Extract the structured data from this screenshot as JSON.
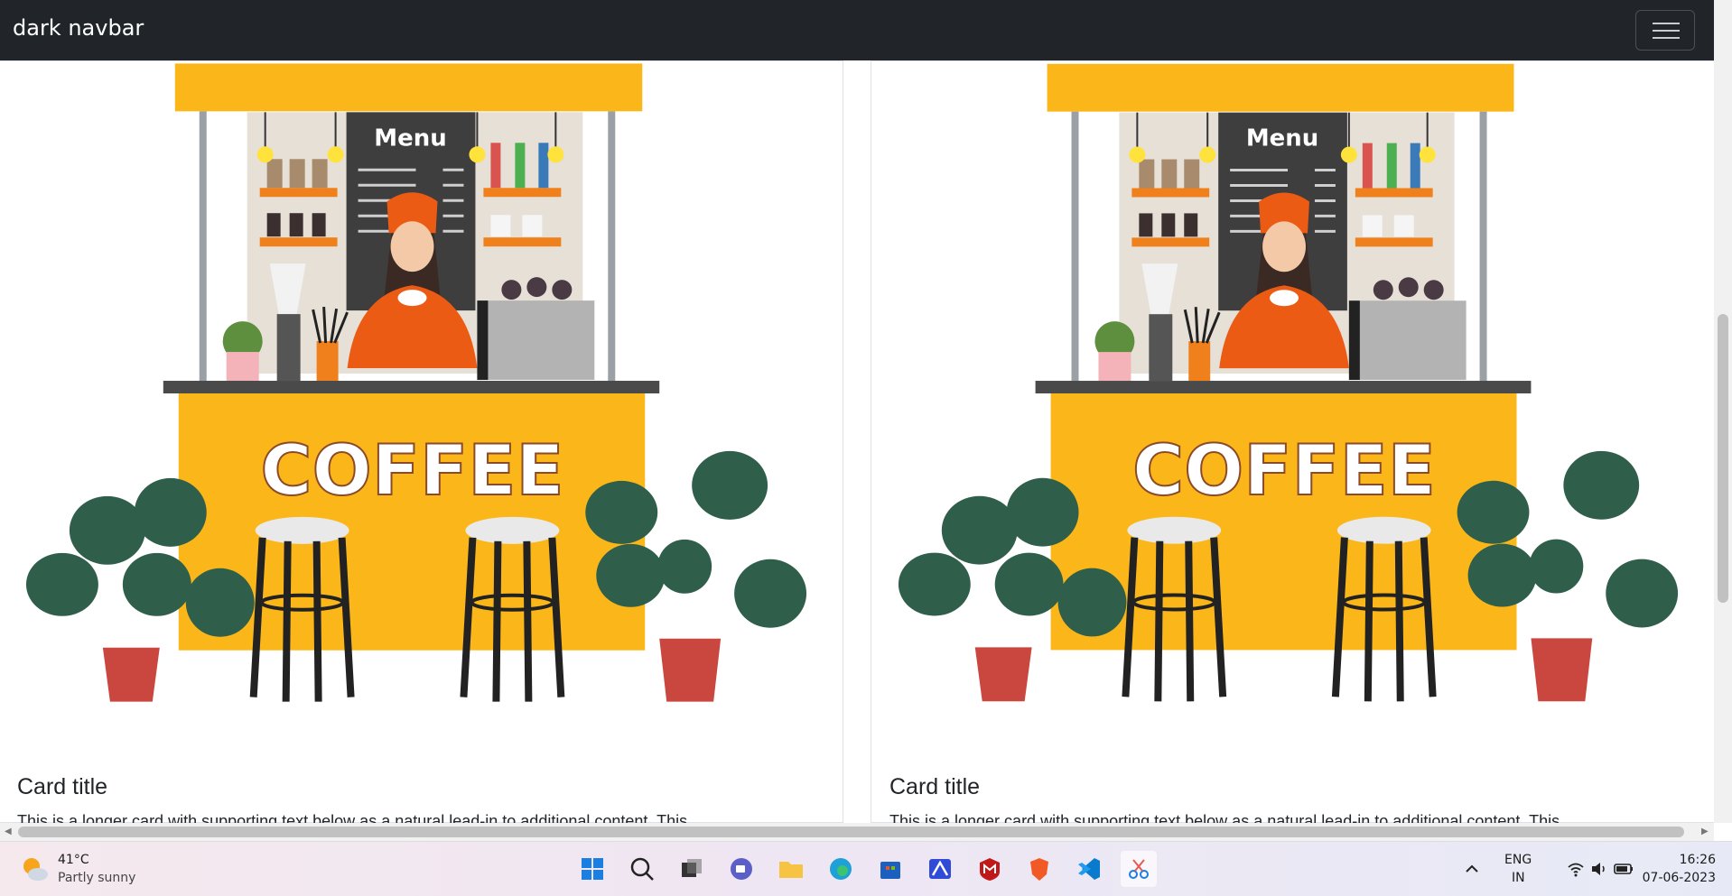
{
  "navbar": {
    "brand": "dark navbar",
    "toggler_icon": "hamburger-icon"
  },
  "cards": [
    {
      "image": {
        "menu_text": "Menu",
        "coffee_text": "COFFEE"
      },
      "title": "Card title",
      "text": "This is a longer card with supporting text below as a natural lead-in to additional content. This"
    },
    {
      "image": {
        "menu_text": "Menu",
        "coffee_text": "COFFEE"
      },
      "title": "Card title",
      "text": "This is a longer card with supporting text below as a natural lead-in to additional content. This"
    }
  ],
  "taskbar": {
    "weather": {
      "temp": "41°C",
      "condition": "Partly sunny",
      "icon": "partly-sunny-icon"
    },
    "apps": [
      "windows-start-icon",
      "search-icon",
      "task-view-icon",
      "chat-icon",
      "file-explorer-icon",
      "edge-icon",
      "store-icon",
      "app-icon",
      "mcafee-icon",
      "brave-icon",
      "vscode-icon",
      "snipping-tool-icon"
    ],
    "tray": {
      "lang1": "ENG",
      "lang2": "IN",
      "time": "16:26",
      "date": "07-06-2023"
    }
  },
  "colors": {
    "navbar_bg": "#212529",
    "kiosk_yellow": "#fbb719",
    "shirt_orange": "#ec5b13"
  }
}
